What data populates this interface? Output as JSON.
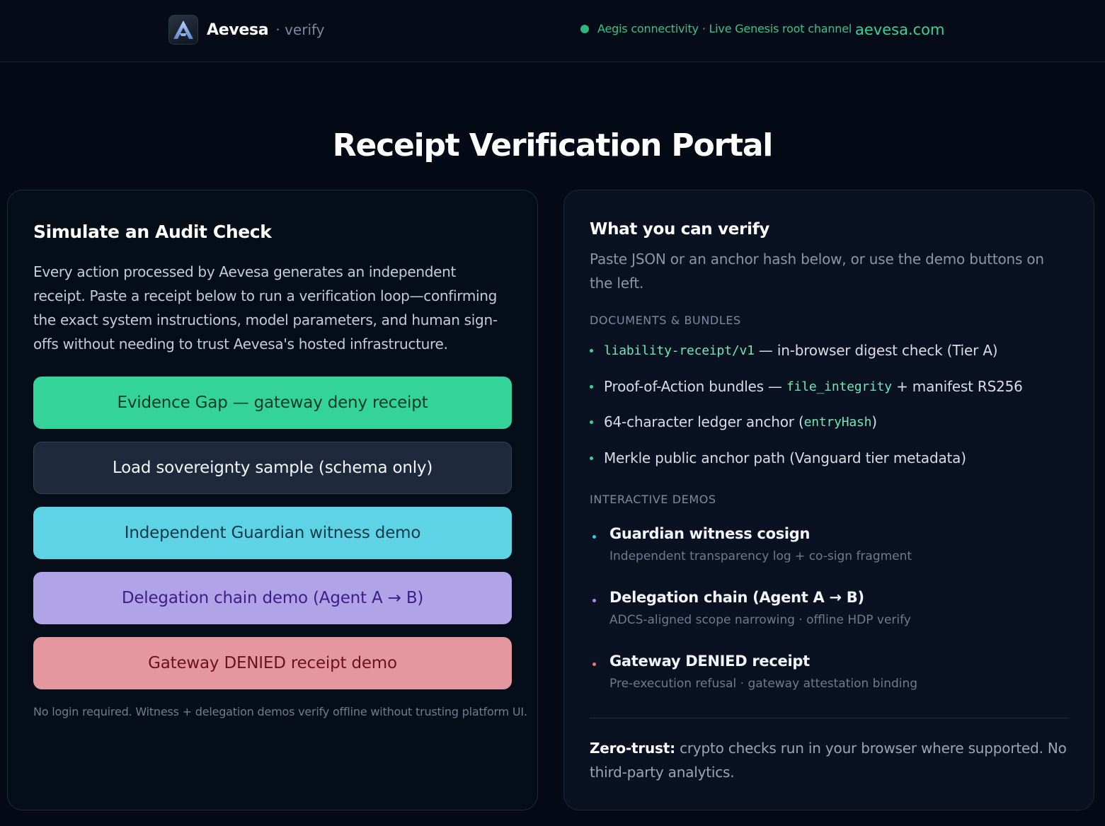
{
  "header": {
    "brand_name": "Aevesa",
    "brand_sub": "· verify",
    "logo_letter": "A",
    "status_text": "Aegis connectivity · Live Genesis root channel",
    "status_color": "#2fb67c",
    "domain_link": "aevesa.com"
  },
  "page_title": "Receipt Verification Portal",
  "left_panel": {
    "heading": "Simulate an Audit Check",
    "description": "Every action processed by Aevesa generates an independent receipt. Paste a receipt below to run a verification loop—confirming the exact system instructions, model parameters, and human sign-offs without needing to trust Aevesa's hosted infrastructure.",
    "buttons": [
      {
        "label": "Evidence Gap — gateway deny receipt",
        "color": "#34d399"
      },
      {
        "label": "Load sovereignty sample (schema only)",
        "color": "#1e293b"
      },
      {
        "label": "Independent Guardian witness demo",
        "color": "#5ed3e6"
      },
      {
        "label": "Delegation chain demo (Agent A → B)",
        "color": "#b1a3e8"
      },
      {
        "label": "Gateway DENIED receipt demo",
        "color": "#e5979f"
      }
    ],
    "footnote": "No login required. Witness + delegation demos verify offline without trusting platform UI."
  },
  "right_panel": {
    "heading": "What you can verify",
    "description": "Paste JSON or an anchor hash below, or use the demo buttons on the left.",
    "docs_label": "DOCUMENTS & BUNDLES",
    "docs": [
      {
        "code": "liability-receipt/v1",
        "text": " — in-browser digest check (Tier A)"
      },
      {
        "pre": "Proof-of-Action bundles — ",
        "code": "file_integrity",
        "post": " + manifest RS256"
      },
      {
        "pre": "64-character ledger anchor (",
        "code": "entryHash",
        "post": ")"
      },
      {
        "text": "Merkle public anchor path (Vanguard tier metadata)"
      }
    ],
    "demos_label": "INTERACTIVE DEMOS",
    "demos": [
      {
        "title": "Guardian witness cosign",
        "subtitle": "Independent transparency log + co-sign fragment",
        "color": "#22d3ee"
      },
      {
        "title": "Delegation chain (Agent A → B)",
        "subtitle": "ADCS-aligned scope narrowing · offline HDP verify",
        "color": "#a78bfa"
      },
      {
        "title": "Gateway DENIED receipt",
        "subtitle": "Pre-execution refusal · gateway attestation binding",
        "color": "#f87171"
      }
    ],
    "zero_trust_label": "Zero-trust:",
    "zero_trust_text": " crypto checks run in your browser where supported. No third-party analytics."
  }
}
